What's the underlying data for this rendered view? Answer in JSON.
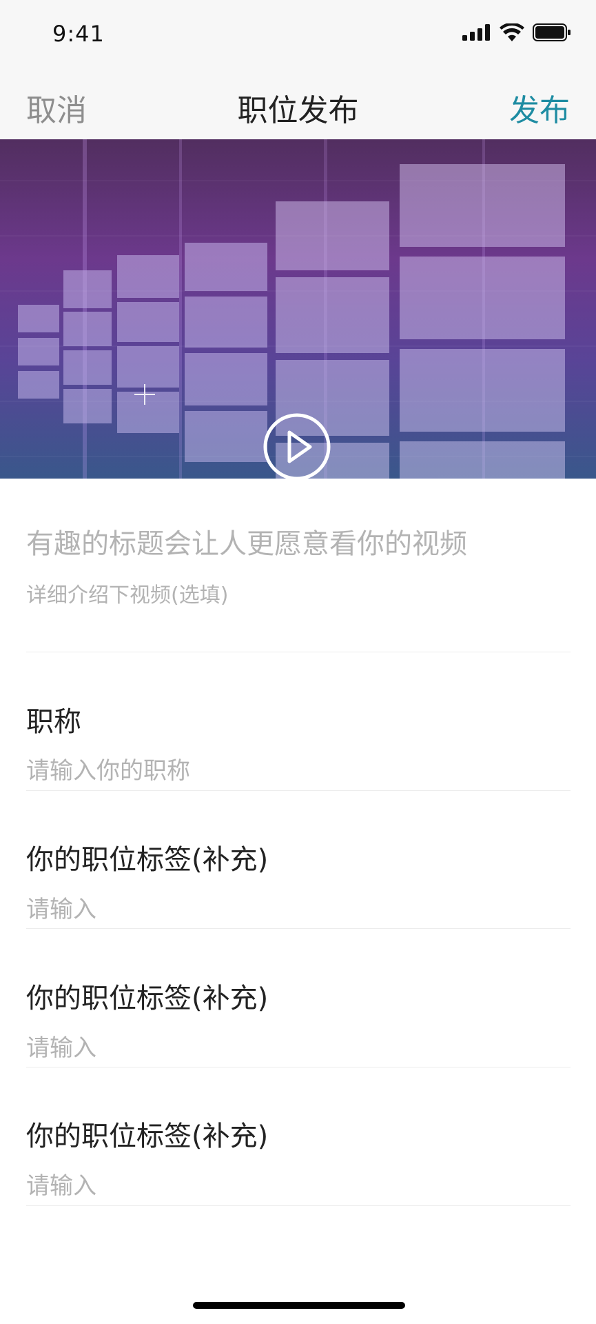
{
  "status_bar": {
    "time": "9:41",
    "icons": [
      "signal-icon",
      "wifi-icon",
      "battery-icon"
    ]
  },
  "nav": {
    "cancel_label": "取消",
    "title": "职位发布",
    "publish_label": "发布",
    "accent_color": "#1e8ca2"
  },
  "video": {
    "play_icon": "play-icon"
  },
  "post": {
    "title_placeholder": "有趣的标题会让人更愿意看你的视频",
    "desc_placeholder": "详细介绍下视频(选填)"
  },
  "fields": [
    {
      "label": "职称",
      "placeholder": "请输入你的职称"
    },
    {
      "label": "你的职位标签(补充)",
      "placeholder": "请输入"
    },
    {
      "label": "你的职位标签(补充)",
      "placeholder": "请输入"
    },
    {
      "label": "你的职位标签(补充)",
      "placeholder": "请输入"
    }
  ]
}
